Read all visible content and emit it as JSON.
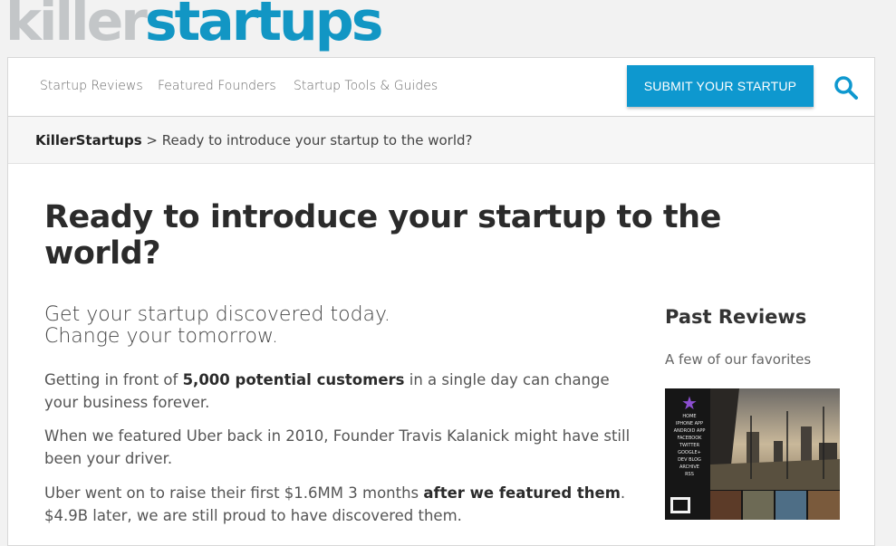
{
  "logo": {
    "part1": "killer",
    "part2": "startups"
  },
  "nav": {
    "links": [
      "Startup Reviews",
      "Featured Founders",
      "Startup Tools & Guides"
    ],
    "submit_label": "SUBMIT YOUR STARTUP",
    "search_icon": "search-icon"
  },
  "breadcrumb": {
    "home": "KillerStartups",
    "separator": ">",
    "current": "Ready to introduce your startup to the world?"
  },
  "main": {
    "title": "Ready to introduce your startup to the world?",
    "lead_line1": "Get your startup discovered today.",
    "lead_line2": "Change your tomorrow.",
    "p1_a": "Getting in front of ",
    "p1_b": "5,000 potential customers",
    "p1_c": " in a single day can change your business forever.",
    "p2": "When we featured Uber back in 2010, Founder Travis Kalanick might have still been your driver.",
    "p3_a": "Uber went on to raise their first $1.6MM 3 months ",
    "p3_b": "after we featured them",
    "p3_c": ". $4.9B later, we are still proud to have discovered them."
  },
  "sidebar": {
    "title": "Past Reviews",
    "subtitle": "A few of our favorites",
    "thumb_menu": [
      "HOME",
      "IPHONE APP",
      "ANDROID APP",
      "FACEBOOK",
      "TWITTER",
      "GOOGLE+",
      "DEV BLOG",
      "ARCHIVE",
      "RSS"
    ]
  },
  "colors": {
    "brand_blue": "#0e98cf",
    "logo_grey": "#c3c6c8"
  }
}
